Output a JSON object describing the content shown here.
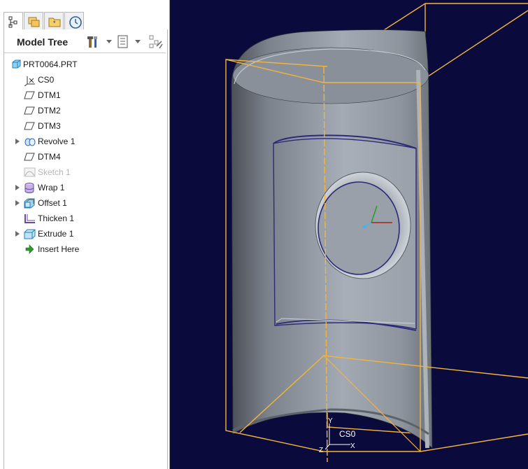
{
  "tabs": [
    {
      "id": "model-tree-tab",
      "icon": "model-tree-icon"
    },
    {
      "id": "folder-browser-tab",
      "icon": "folder-browser-icon"
    },
    {
      "id": "favorites-tab",
      "icon": "favorites-icon"
    },
    {
      "id": "history-tab",
      "icon": "history-icon"
    }
  ],
  "model_tree": {
    "title": "Model Tree",
    "toolbar": [
      "settings-icon",
      "tree-filters-icon",
      "show-icon"
    ],
    "nodes": [
      {
        "label": "PRT0064.PRT",
        "icon": "part-icon"
      },
      {
        "label": "CS0",
        "icon": "coordinate-system-icon"
      },
      {
        "label": "DTM1",
        "icon": "datum-plane-icon"
      },
      {
        "label": "DTM2",
        "icon": "datum-plane-icon"
      },
      {
        "label": "DTM3",
        "icon": "datum-plane-icon"
      },
      {
        "label": "Revolve 1",
        "icon": "revolve-icon",
        "expandable": true
      },
      {
        "label": "DTM4",
        "icon": "datum-plane-icon"
      },
      {
        "label": "Sketch 1",
        "icon": "sketch-icon",
        "suppressed": true
      },
      {
        "label": "Wrap 1",
        "icon": "wrap-icon",
        "expandable": true
      },
      {
        "label": "Offset 1",
        "icon": "offset-icon",
        "expandable": true
      },
      {
        "label": "Thicken 1",
        "icon": "thicken-icon"
      },
      {
        "label": "Extrude 1",
        "icon": "extrude-icon",
        "expandable": true
      },
      {
        "label": "Insert Here",
        "icon": "insert-here-arrow-icon"
      }
    ]
  },
  "viewport": {
    "background": "#0a0a3c",
    "csys_label": "CS0",
    "axis_y": "Y",
    "axis_z": "Z",
    "axis_x": "X"
  },
  "colors": {
    "datum_plane": "#f2b53a",
    "sketch_edge": "#2a2a78",
    "selected_tab_border": "#b9b9b9"
  }
}
